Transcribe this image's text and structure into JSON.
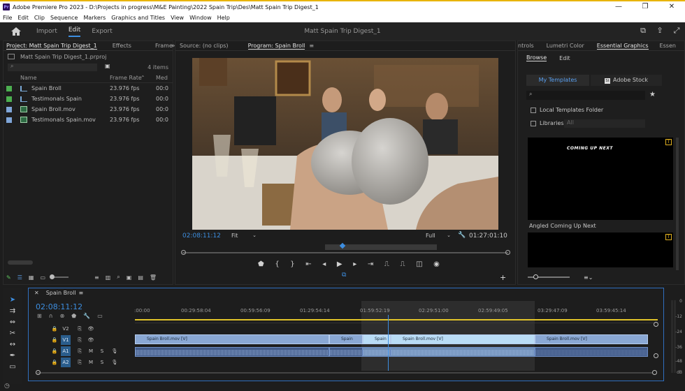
{
  "window": {
    "title": "Adobe Premiere Pro 2023 - D:\\Projects in progress\\M&E Painting\\2022 Spain Trip\\Des\\Matt Spain Trip Digest_1",
    "app_logo": "Pr",
    "controls": [
      "—",
      "❐",
      "✕"
    ]
  },
  "menu": [
    "File",
    "Edit",
    "Clip",
    "Sequence",
    "Markers",
    "Graphics and Titles",
    "View",
    "Window",
    "Help"
  ],
  "header": {
    "workspaces": [
      "Import",
      "Edit",
      "Export"
    ],
    "active_workspace": "Edit",
    "project_title": "Matt Spain Trip Digest_1"
  },
  "project_panel": {
    "tabs": [
      "Project: Matt Spain Trip Digest_1",
      "Effects",
      "Frame.io"
    ],
    "file": "Matt Spain Trip Digest_1.prproj",
    "item_count": "4 items",
    "columns": [
      "Name",
      "Frame Rate",
      "Med"
    ],
    "items": [
      {
        "name": "Spain Broll",
        "fps": "23.976 fps",
        "med": "00:0",
        "color": "#4caf50",
        "kind": "sequence"
      },
      {
        "name": "Testimonals Spain",
        "fps": "23.976 fps",
        "med": "00:0",
        "color": "#4caf50",
        "kind": "sequence"
      },
      {
        "name": "Spain Broll.mov",
        "fps": "23.976 fps",
        "med": "00:0",
        "color": "#7fa6d9",
        "kind": "clip"
      },
      {
        "name": "Testimonals Spain.mov",
        "fps": "23.976 fps",
        "med": "00:0",
        "color": "#7fa6d9",
        "kind": "clip"
      }
    ]
  },
  "source_panel": {
    "label": "Source: (no clips)"
  },
  "program_panel": {
    "tab": "Program: Spain Broll",
    "timecode_in": "02:08:11:12",
    "fit": "Fit",
    "quality": "Full",
    "duration": "01:27:01:10"
  },
  "graphics_panel": {
    "tabs": [
      "ntrols",
      "Lumetri Color",
      "Essential Graphics",
      "Essen"
    ],
    "subtabs": [
      "Browse",
      "Edit"
    ],
    "template_tabs": [
      "My Templates",
      "Adobe Stock"
    ],
    "local_templates": "Local Templates Folder",
    "libraries": "Libraries",
    "libraries_dropdown": "All",
    "template1_text": "COMING UP NEXT",
    "template1_name": "Angled Coming Up Next"
  },
  "timeline": {
    "tab": "Spain Broll",
    "timecode": "02:08:11:12",
    "ruler": [
      ":00:00",
      "00:29:58:04",
      "00:59:56:09",
      "01:29:54:14",
      "01:59:52:19",
      "02:29:51:00",
      "02:59:49:05",
      "03:29:47:09",
      "03:59:45:14"
    ],
    "tracks": [
      "V2",
      "V1",
      "A1",
      "A2"
    ],
    "clips": [
      "Spain Broll.mov [V]",
      "Spain",
      "Spain",
      "Spain Broll.mov [V]",
      "Spain Broll.mov [V]"
    ],
    "meter": [
      "0",
      "-12",
      "-24",
      "-36",
      "-48",
      "dB"
    ],
    "track_buttons": [
      "M",
      "S",
      "M",
      "S"
    ]
  }
}
